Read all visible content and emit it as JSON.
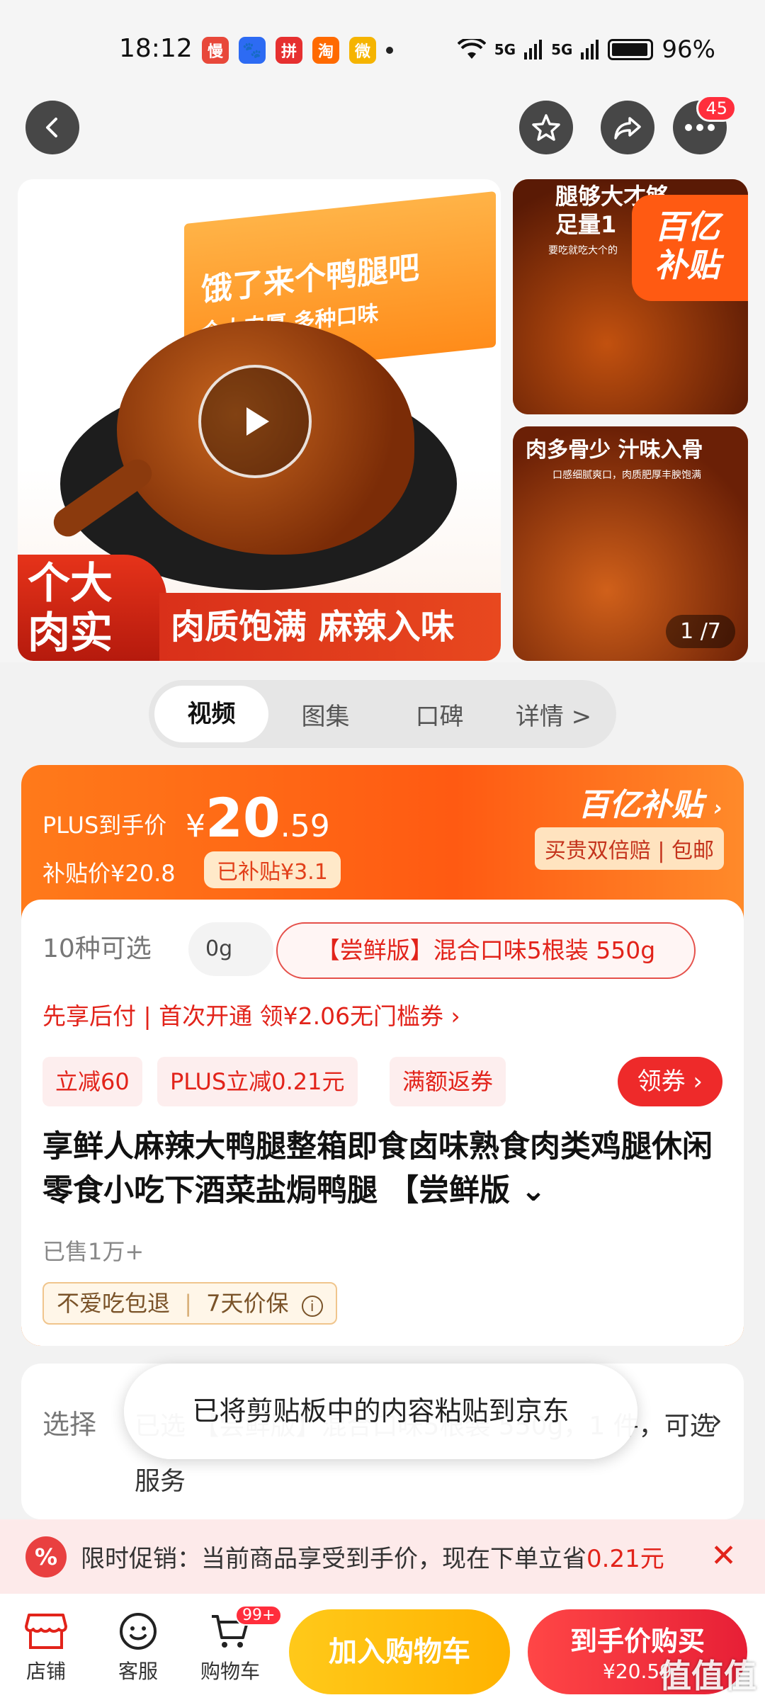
{
  "status_bar": {
    "time": "18:12",
    "apps": [
      {
        "name": "manhua-app-icon",
        "glyph": "慢",
        "color": "#e8483a"
      },
      {
        "name": "baidu-app-icon",
        "glyph": "🐾",
        "color": "#2d6bf3"
      },
      {
        "name": "pinduoduo-app-icon",
        "glyph": "拼",
        "color": "#e63030"
      },
      {
        "name": "taobao-app-icon",
        "glyph": "淘",
        "color": "#ff6a00"
      },
      {
        "name": "weibo-app-icon",
        "glyph": "微",
        "color": "#f5b400"
      }
    ],
    "network_1": "5G",
    "network_2": "5G",
    "battery": "96%"
  },
  "nav": {
    "more_badge": "45"
  },
  "gallery": {
    "main_caption_left": "个大\n肉实",
    "main_caption_right": "肉质饱满 麻辣入味",
    "box_text_1": "饿了来个鸭腿吧",
    "box_text_2": "个大肉厚 多种口味",
    "side1_text": "腿够大才够\n足量1",
    "side1_sub": "要吃就吃大个的",
    "subsidy_badge": "百亿\n补贴",
    "side2_text": "肉多骨少 汁味入骨",
    "side2_sub": "口感细腻爽口，肉质肥厚丰腴饱满",
    "counter": "1  /7"
  },
  "tabs": [
    {
      "label": "视频",
      "active": true
    },
    {
      "label": "图集",
      "active": false
    },
    {
      "label": "口碑",
      "active": false
    },
    {
      "label": "详情 >",
      "active": false
    }
  ],
  "price": {
    "plus_label": "PLUS到手价",
    "currency": "¥",
    "integer": "20",
    "decimal": ".59",
    "subsidy_price": "补贴价¥20.8",
    "subsidy_tag": "已补贴¥3.1",
    "brand": "百亿补贴",
    "brand_sub": "买贵双倍赔 | 包邮"
  },
  "variants": {
    "count_label": "10种可选",
    "chip_partial": "0g",
    "selected": "【尝鲜版】混合口味5根装 550g"
  },
  "pay_line": "先享后付 | 首次开通 领¥2.06无门槛券 ›",
  "promos": [
    "立减60",
    "PLUS立减0.21元",
    "满额返券"
  ],
  "coupon_button": "领券",
  "product_title": "享鲜人麻辣大鸭腿整箱即食卤味熟食肉类鸡腿休闲零食小吃下酒菜盐焗鸭腿 【尝鲜版",
  "sold": "已售1万+",
  "guarantees": [
    "不爱吃包退",
    "7天价保"
  ],
  "select": {
    "label": "选择",
    "text": "已选 【尝鲜版】混合口味5根装 550g，1 件，可选服务",
    "arrow": "›"
  },
  "toast": "已将剪贴板中的内容粘贴到京东",
  "limit_promo": {
    "prefix": "限时促销：当前商品享受到手价，现在下单立省",
    "amount": "0.21元",
    "close": "✕"
  },
  "bottom_bar": {
    "shop": "店铺",
    "service": "客服",
    "cart": "购物车",
    "cart_badge": "99+",
    "add_to_cart": "加入购物车",
    "buy_now": "到手价购买",
    "buy_price": "¥20.59"
  },
  "watermark": "值值值",
  "colors": {
    "accent_red": "#e2231a",
    "accent_orange": "#ff5a12",
    "cart_yellow": "#ffb300"
  }
}
